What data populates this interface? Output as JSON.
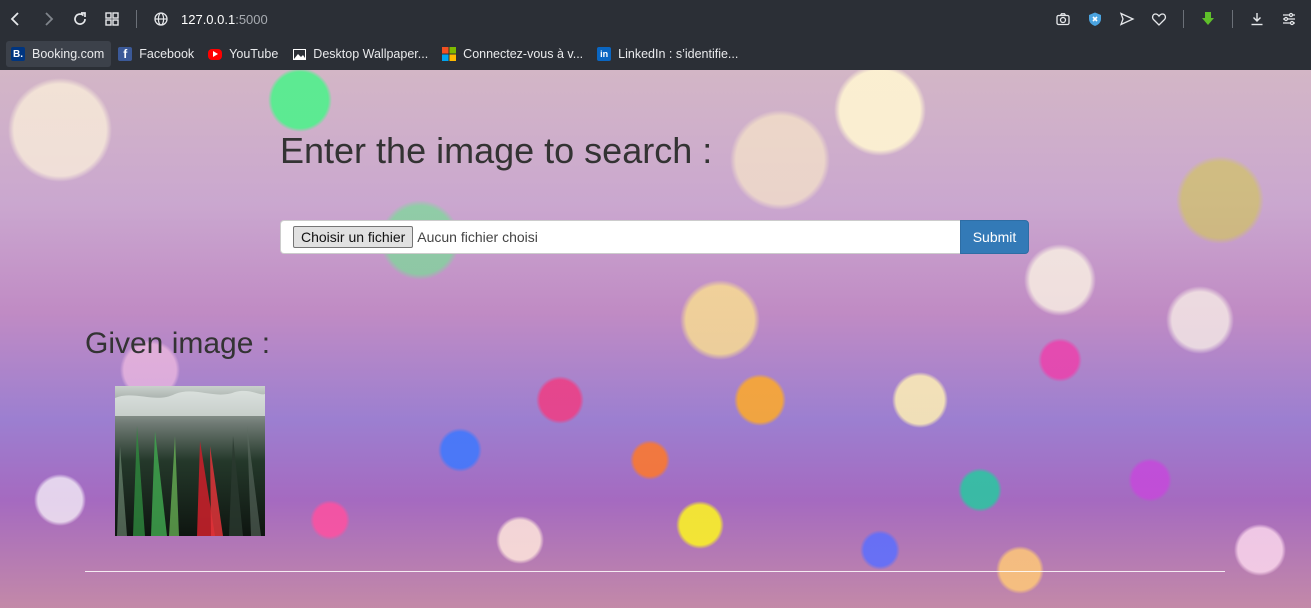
{
  "browser": {
    "url_host": "127.0.0.1",
    "url_port": ":5000"
  },
  "bookmarks": [
    {
      "label": "Booking.com",
      "icon": "booking-icon",
      "color": "#003580"
    },
    {
      "label": "Facebook",
      "icon": "facebook-icon",
      "color": "#3b5998"
    },
    {
      "label": "YouTube",
      "icon": "youtube-icon",
      "color": "#ff0000"
    },
    {
      "label": "Desktop Wallpaper...",
      "icon": "image-icon",
      "color": "#ffffff"
    },
    {
      "label": "Connectez-vous à v...",
      "icon": "microsoft-icon",
      "color": "#f25022"
    },
    {
      "label": "LinkedIn : s’identifie...",
      "icon": "linkedin-icon",
      "color": "#0a66c2"
    }
  ],
  "page": {
    "title": "Enter the image to search :",
    "file_button_label": "Choisir un fichier",
    "file_status": "Aucun fichier choisi",
    "submit_label": "Submit",
    "given_title": "Given image :"
  },
  "colors": {
    "submit": "#337ab7",
    "chrome": "#2b2f36"
  }
}
